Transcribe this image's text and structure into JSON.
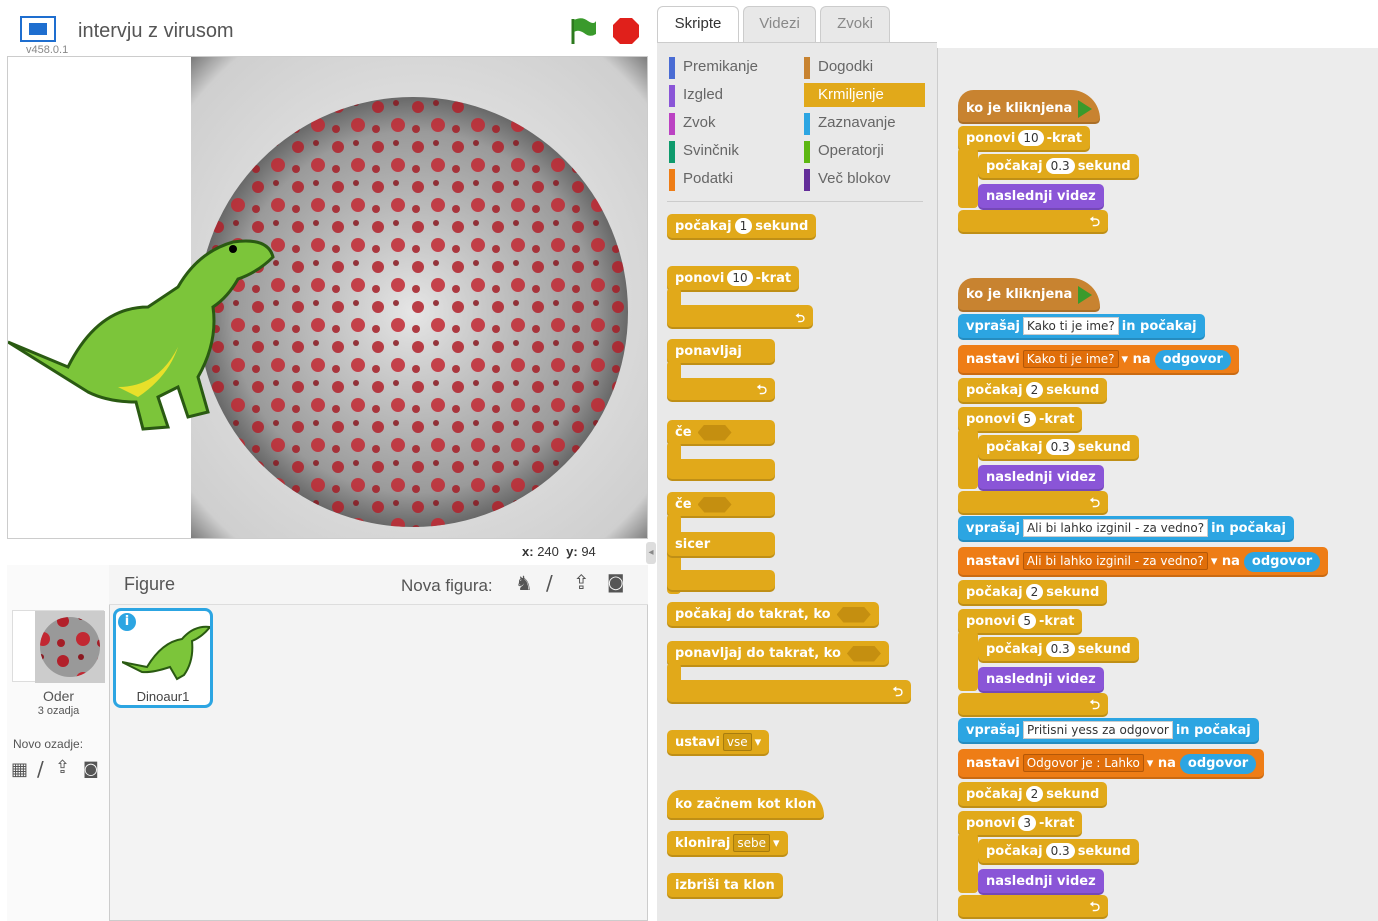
{
  "app": {
    "project_title": "intervju z virusom",
    "version": "v458.0.1"
  },
  "stage": {
    "x_label": "x:",
    "x_value": "240",
    "y_label": "y:",
    "y_value": "94"
  },
  "sprites_pane": {
    "header": "Figure",
    "new_sprite_label": "Nova figura:",
    "stage_name": "Oder",
    "stage_backdrops": "3 ozadja",
    "new_backdrop_label": "Novo ozadje:",
    "sprites": [
      {
        "name": "Dinoaur1"
      }
    ]
  },
  "tabs": [
    {
      "label": "Skripte",
      "active": true
    },
    {
      "label": "Videzi",
      "active": false
    },
    {
      "label": "Zvoki",
      "active": false
    }
  ],
  "categories": {
    "left": [
      {
        "label": "Premikanje",
        "color": "#4a6cd4"
      },
      {
        "label": "Izgled",
        "color": "#8a55d7"
      },
      {
        "label": "Zvok",
        "color": "#bb42c3"
      },
      {
        "label": "Svinčnik",
        "color": "#0e9a6c"
      },
      {
        "label": "Podatki",
        "color": "#ee7d16"
      }
    ],
    "right": [
      {
        "label": "Dogodki",
        "color": "#c88330"
      },
      {
        "label": "Krmiljenje",
        "color": "#e1a91a",
        "selected": true
      },
      {
        "label": "Zaznavanje",
        "color": "#2ca5e2"
      },
      {
        "label": "Operatorji",
        "color": "#5cb712"
      },
      {
        "label": "Več blokov",
        "color": "#632d99"
      }
    ]
  },
  "palette": {
    "wait": "počakaj",
    "wait_val": "1",
    "seconds": "sekund",
    "repeat": "ponovi",
    "repeat_val": "10",
    "times": "-krat",
    "forever": "ponavljaj",
    "if": "če",
    "else": "sicer",
    "wait_until": "počakaj do takrat, ko",
    "repeat_until": "ponavljaj do takrat, ko",
    "stop": "ustavi",
    "stop_val": "vse",
    "when_clone": "ko začnem kot klon",
    "clone": "kloniraj",
    "clone_val": "sebe",
    "delete_clone": "izbriši ta klon"
  },
  "script": {
    "when_clicked": "ko je kliknjena",
    "repeat": "ponovi",
    "times": "-krat",
    "wait": "počakaj",
    "seconds": "sekund",
    "next_costume": "naslednji videz",
    "ask": "vprašaj",
    "and_wait": "in počakaj",
    "set": "nastavi",
    "to": "na",
    "answer": "odgovor",
    "s1_repeat": "10",
    "s1_wait": "0.3",
    "q1": "Kako ti je ime?",
    "v1": "Kako ti je ime?",
    "w2": "2",
    "r5": "5",
    "w03": "0.3",
    "q2": "Ali bi lahko izginil - za vedno?",
    "v2": "Ali bi lahko izginil - za vedno?",
    "q3": "Pritisni  yess za odgovor",
    "v3": "Odgovor je : Lahko",
    "r3": "3"
  }
}
